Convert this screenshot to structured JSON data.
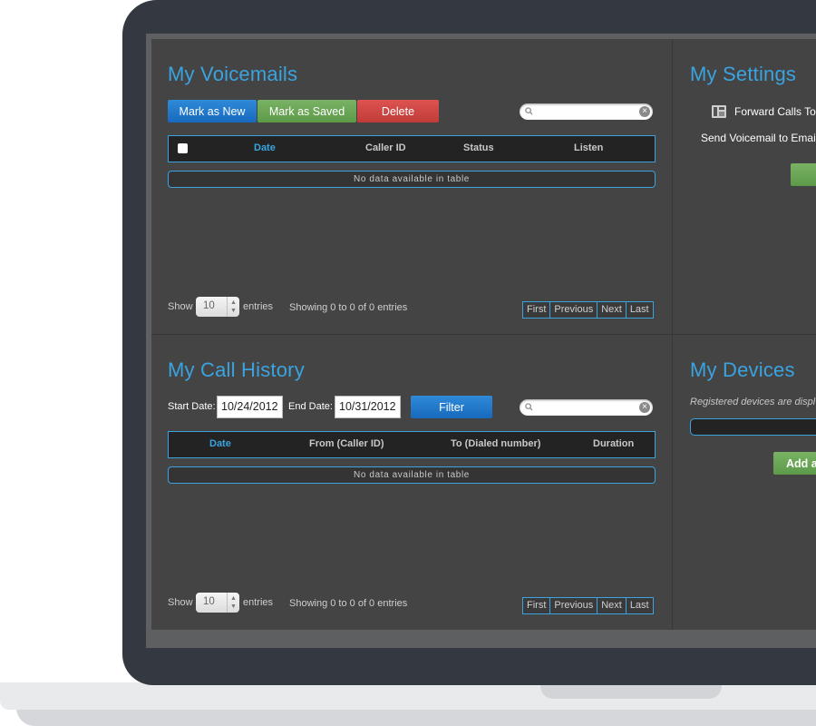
{
  "voicemails": {
    "title": "My Voicemails",
    "buttons": {
      "mark_new": "Mark as New",
      "mark_saved": "Mark as Saved",
      "delete": "Delete"
    },
    "columns": [
      "Date",
      "Caller ID",
      "Status",
      "Listen"
    ],
    "empty_text": "No data available in table",
    "show_label": "Show",
    "entries_value": "10",
    "entries_label": "entries",
    "info": "Showing 0 to 0 of 0 entries",
    "pager": [
      "First",
      "Previous",
      "Next",
      "Last"
    ]
  },
  "call_history": {
    "title": "My Call History",
    "start_label": "Start Date:",
    "start_value": "10/24/2012",
    "end_label": "End Date:",
    "end_value": "10/31/2012",
    "filter_button": "Filter",
    "columns": [
      "Date",
      "From (Caller ID)",
      "To (Dialed number)",
      "Duration"
    ],
    "empty_text": "No data available in table",
    "show_label": "Show",
    "entries_value": "10",
    "entries_label": "entries",
    "info": "Showing 0 to 0 of 0 entries",
    "pager": [
      "First",
      "Previous",
      "Next",
      "Last"
    ]
  },
  "settings": {
    "title": "My Settings",
    "forward_label": "Forward Calls To",
    "voicemail_label": "Send Voicemail to Email"
  },
  "devices": {
    "title": "My Devices",
    "registered_text": "Registered devices are displ",
    "add_button": "Add a"
  },
  "colors": {
    "accent": "#3aa3e0",
    "panel": "#444444",
    "blue_btn": "#1f77c9",
    "green_btn": "#6aa855",
    "red_btn": "#cf4744"
  }
}
